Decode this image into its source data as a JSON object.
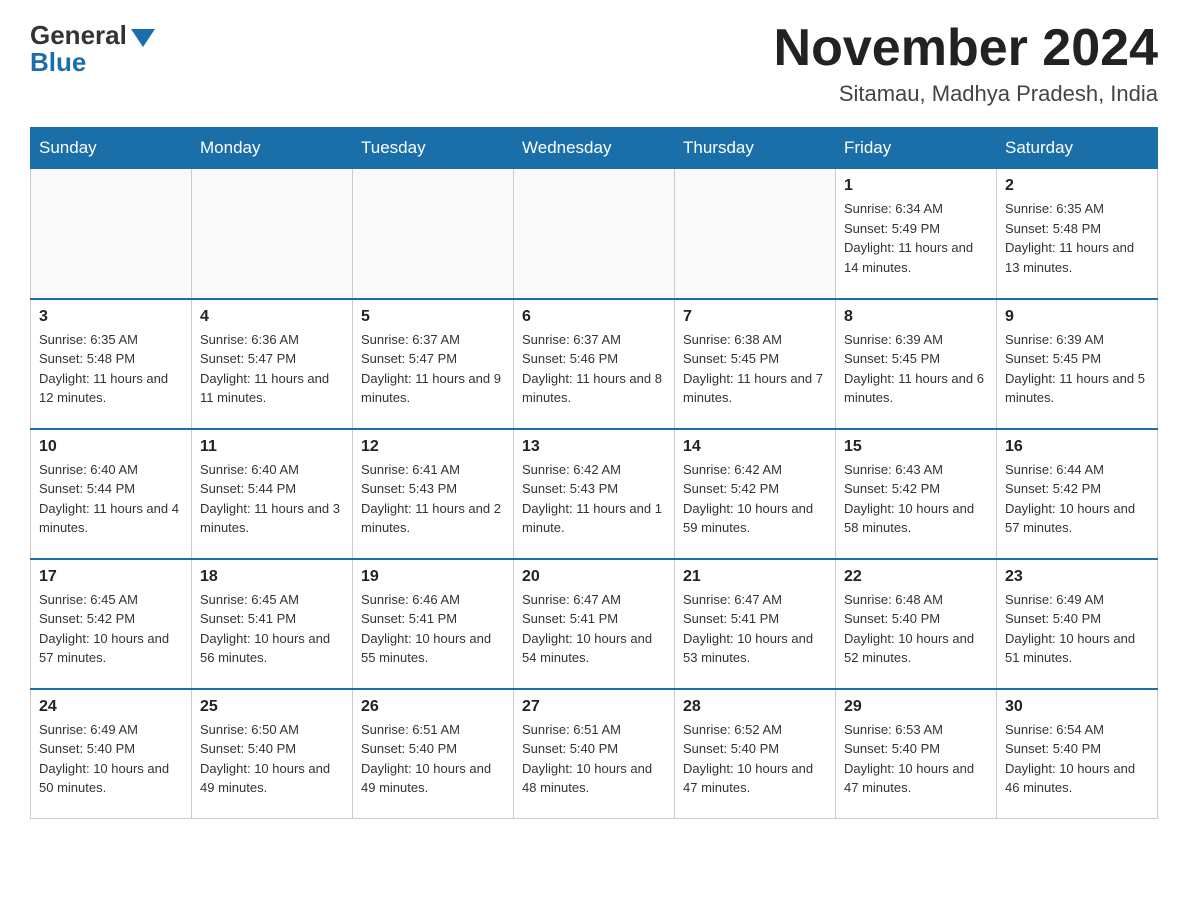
{
  "header": {
    "logo_general": "General",
    "logo_blue": "Blue",
    "month_title": "November 2024",
    "location": "Sitamau, Madhya Pradesh, India"
  },
  "days_of_week": [
    "Sunday",
    "Monday",
    "Tuesday",
    "Wednesday",
    "Thursday",
    "Friday",
    "Saturday"
  ],
  "weeks": [
    [
      {
        "day": "",
        "info": ""
      },
      {
        "day": "",
        "info": ""
      },
      {
        "day": "",
        "info": ""
      },
      {
        "day": "",
        "info": ""
      },
      {
        "day": "",
        "info": ""
      },
      {
        "day": "1",
        "info": "Sunrise: 6:34 AM\nSunset: 5:49 PM\nDaylight: 11 hours and 14 minutes."
      },
      {
        "day": "2",
        "info": "Sunrise: 6:35 AM\nSunset: 5:48 PM\nDaylight: 11 hours and 13 minutes."
      }
    ],
    [
      {
        "day": "3",
        "info": "Sunrise: 6:35 AM\nSunset: 5:48 PM\nDaylight: 11 hours and 12 minutes."
      },
      {
        "day": "4",
        "info": "Sunrise: 6:36 AM\nSunset: 5:47 PM\nDaylight: 11 hours and 11 minutes."
      },
      {
        "day": "5",
        "info": "Sunrise: 6:37 AM\nSunset: 5:47 PM\nDaylight: 11 hours and 9 minutes."
      },
      {
        "day": "6",
        "info": "Sunrise: 6:37 AM\nSunset: 5:46 PM\nDaylight: 11 hours and 8 minutes."
      },
      {
        "day": "7",
        "info": "Sunrise: 6:38 AM\nSunset: 5:45 PM\nDaylight: 11 hours and 7 minutes."
      },
      {
        "day": "8",
        "info": "Sunrise: 6:39 AM\nSunset: 5:45 PM\nDaylight: 11 hours and 6 minutes."
      },
      {
        "day": "9",
        "info": "Sunrise: 6:39 AM\nSunset: 5:45 PM\nDaylight: 11 hours and 5 minutes."
      }
    ],
    [
      {
        "day": "10",
        "info": "Sunrise: 6:40 AM\nSunset: 5:44 PM\nDaylight: 11 hours and 4 minutes."
      },
      {
        "day": "11",
        "info": "Sunrise: 6:40 AM\nSunset: 5:44 PM\nDaylight: 11 hours and 3 minutes."
      },
      {
        "day": "12",
        "info": "Sunrise: 6:41 AM\nSunset: 5:43 PM\nDaylight: 11 hours and 2 minutes."
      },
      {
        "day": "13",
        "info": "Sunrise: 6:42 AM\nSunset: 5:43 PM\nDaylight: 11 hours and 1 minute."
      },
      {
        "day": "14",
        "info": "Sunrise: 6:42 AM\nSunset: 5:42 PM\nDaylight: 10 hours and 59 minutes."
      },
      {
        "day": "15",
        "info": "Sunrise: 6:43 AM\nSunset: 5:42 PM\nDaylight: 10 hours and 58 minutes."
      },
      {
        "day": "16",
        "info": "Sunrise: 6:44 AM\nSunset: 5:42 PM\nDaylight: 10 hours and 57 minutes."
      }
    ],
    [
      {
        "day": "17",
        "info": "Sunrise: 6:45 AM\nSunset: 5:42 PM\nDaylight: 10 hours and 57 minutes."
      },
      {
        "day": "18",
        "info": "Sunrise: 6:45 AM\nSunset: 5:41 PM\nDaylight: 10 hours and 56 minutes."
      },
      {
        "day": "19",
        "info": "Sunrise: 6:46 AM\nSunset: 5:41 PM\nDaylight: 10 hours and 55 minutes."
      },
      {
        "day": "20",
        "info": "Sunrise: 6:47 AM\nSunset: 5:41 PM\nDaylight: 10 hours and 54 minutes."
      },
      {
        "day": "21",
        "info": "Sunrise: 6:47 AM\nSunset: 5:41 PM\nDaylight: 10 hours and 53 minutes."
      },
      {
        "day": "22",
        "info": "Sunrise: 6:48 AM\nSunset: 5:40 PM\nDaylight: 10 hours and 52 minutes."
      },
      {
        "day": "23",
        "info": "Sunrise: 6:49 AM\nSunset: 5:40 PM\nDaylight: 10 hours and 51 minutes."
      }
    ],
    [
      {
        "day": "24",
        "info": "Sunrise: 6:49 AM\nSunset: 5:40 PM\nDaylight: 10 hours and 50 minutes."
      },
      {
        "day": "25",
        "info": "Sunrise: 6:50 AM\nSunset: 5:40 PM\nDaylight: 10 hours and 49 minutes."
      },
      {
        "day": "26",
        "info": "Sunrise: 6:51 AM\nSunset: 5:40 PM\nDaylight: 10 hours and 49 minutes."
      },
      {
        "day": "27",
        "info": "Sunrise: 6:51 AM\nSunset: 5:40 PM\nDaylight: 10 hours and 48 minutes."
      },
      {
        "day": "28",
        "info": "Sunrise: 6:52 AM\nSunset: 5:40 PM\nDaylight: 10 hours and 47 minutes."
      },
      {
        "day": "29",
        "info": "Sunrise: 6:53 AM\nSunset: 5:40 PM\nDaylight: 10 hours and 47 minutes."
      },
      {
        "day": "30",
        "info": "Sunrise: 6:54 AM\nSunset: 5:40 PM\nDaylight: 10 hours and 46 minutes."
      }
    ]
  ]
}
